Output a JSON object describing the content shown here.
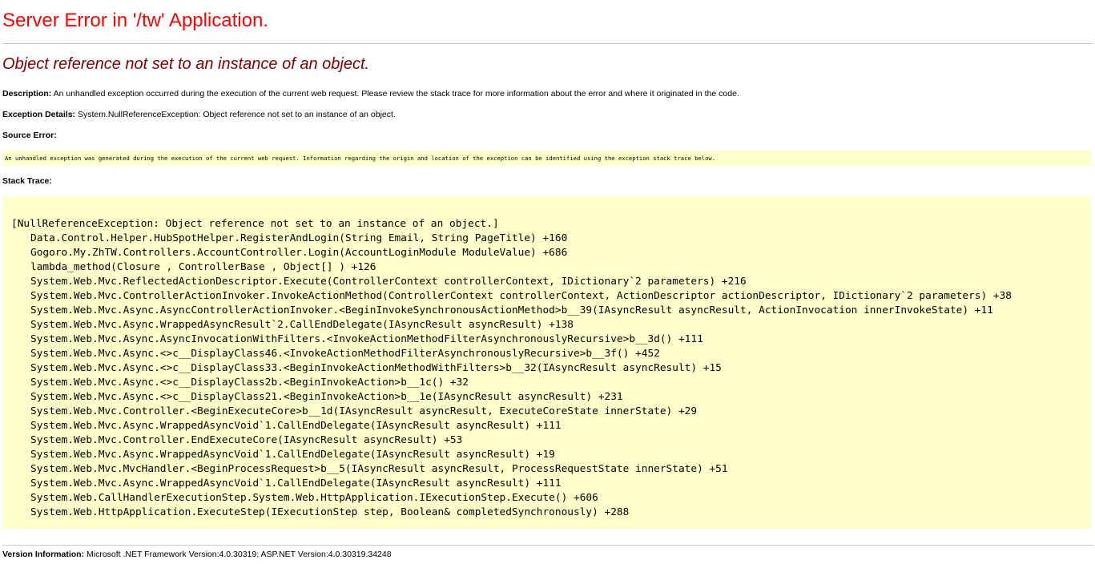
{
  "page": {
    "title": "Server Error in '/tw' Application.",
    "error_message": "Object reference not set to an instance of an object."
  },
  "description": {
    "label": "Description:",
    "text": " An unhandled exception occurred during the execution of the current web request. Please review the stack trace for more information about the error and where it originated in the code."
  },
  "exception_details": {
    "label": "Exception Details:",
    "text": " System.NullReferenceException: Object reference not set to an instance of an object."
  },
  "source_error": {
    "label": "Source Error:",
    "text": "An unhandled exception was generated during the execution of the current web request. Information regarding the origin and location of the exception can be identified using the exception stack trace below."
  },
  "stack_trace": {
    "label": "Stack Trace:",
    "header": "[NullReferenceException: Object reference not set to an instance of an object.]",
    "frames": [
      "Data.Control.Helper.HubSpotHelper.RegisterAndLogin(String Email, String PageTitle) +160",
      "Gogoro.My.ZhTW.Controllers.AccountController.Login(AccountLoginModule ModuleValue) +686",
      "lambda_method(Closure , ControllerBase , Object[] ) +126",
      "System.Web.Mvc.ReflectedActionDescriptor.Execute(ControllerContext controllerContext, IDictionary`2 parameters) +216",
      "System.Web.Mvc.ControllerActionInvoker.InvokeActionMethod(ControllerContext controllerContext, ActionDescriptor actionDescriptor, IDictionary`2 parameters) +38",
      "System.Web.Mvc.Async.AsyncControllerActionInvoker.<BeginInvokeSynchronousActionMethod>b__39(IAsyncResult asyncResult, ActionInvocation innerInvokeState) +11",
      "System.Web.Mvc.Async.WrappedAsyncResult`2.CallEndDelegate(IAsyncResult asyncResult) +138",
      "System.Web.Mvc.Async.AsyncInvocationWithFilters.<InvokeActionMethodFilterAsynchronouslyRecursive>b__3d() +111",
      "System.Web.Mvc.Async.<>c__DisplayClass46.<InvokeActionMethodFilterAsynchronouslyRecursive>b__3f() +452",
      "System.Web.Mvc.Async.<>c__DisplayClass33.<BeginInvokeActionMethodWithFilters>b__32(IAsyncResult asyncResult) +15",
      "System.Web.Mvc.Async.<>c__DisplayClass2b.<BeginInvokeAction>b__1c() +32",
      "System.Web.Mvc.Async.<>c__DisplayClass21.<BeginInvokeAction>b__1e(IAsyncResult asyncResult) +231",
      "System.Web.Mvc.Controller.<BeginExecuteCore>b__1d(IAsyncResult asyncResult, ExecuteCoreState innerState) +29",
      "System.Web.Mvc.Async.WrappedAsyncVoid`1.CallEndDelegate(IAsyncResult asyncResult) +111",
      "System.Web.Mvc.Controller.EndExecuteCore(IAsyncResult asyncResult) +53",
      "System.Web.Mvc.Async.WrappedAsyncVoid`1.CallEndDelegate(IAsyncResult asyncResult) +19",
      "System.Web.Mvc.MvcHandler.<BeginProcessRequest>b__5(IAsyncResult asyncResult, ProcessRequestState innerState) +51",
      "System.Web.Mvc.Async.WrappedAsyncVoid`1.CallEndDelegate(IAsyncResult asyncResult) +111",
      "System.Web.CallHandlerExecutionStep.System.Web.HttpApplication.IExecutionStep.Execute() +606",
      "System.Web.HttpApplication.ExecuteStep(IExecutionStep step, Boolean& completedSynchronously) +288"
    ]
  },
  "version_information": {
    "label": "Version Information:",
    "text": " Microsoft .NET Framework Version:4.0.30319; ASP.NET Version:4.0.30319.34248"
  },
  "colors": {
    "title": "#ff0000",
    "error_message": "#800000",
    "code_background": "#ffffcc"
  }
}
